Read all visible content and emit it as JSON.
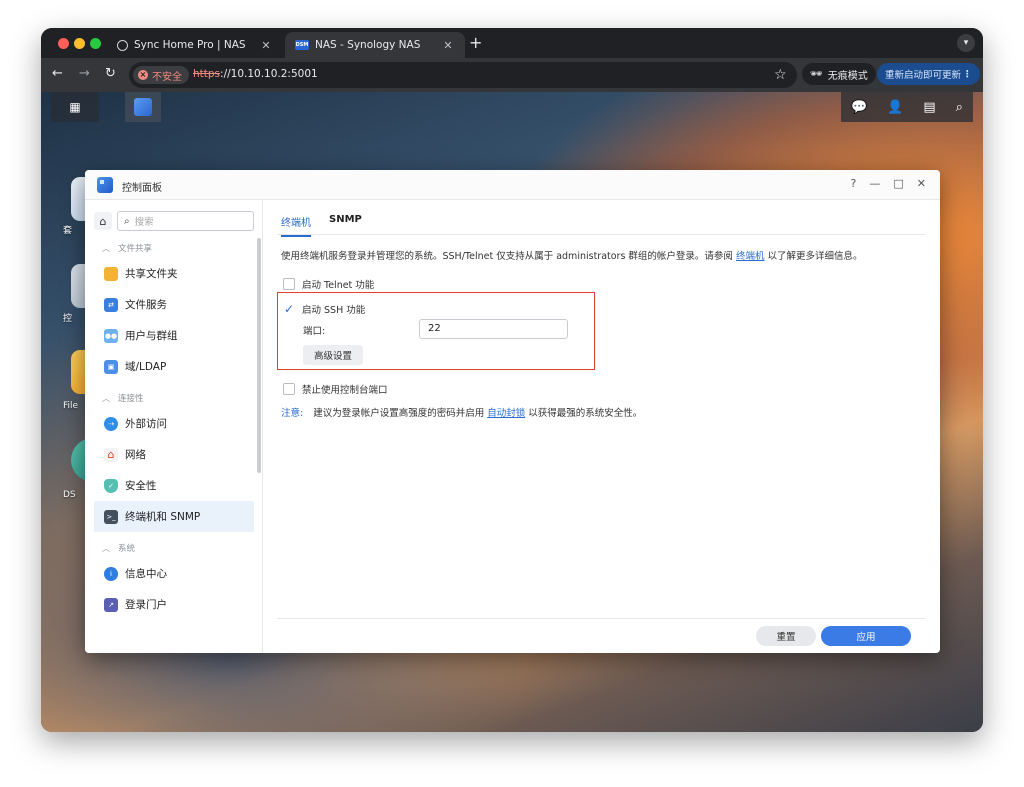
{
  "browser": {
    "tabs": [
      {
        "title": "Sync Home Pro | NAS",
        "close": "✕"
      },
      {
        "title": "NAS - Synology NAS",
        "close": "✕",
        "icon_text": "DSM"
      }
    ],
    "new_tab": "+",
    "address": {
      "security_label": "不安全",
      "scheme": "https",
      "rest": "://10.10.10.2:5001"
    },
    "incognito_label": "无痕模式",
    "relaunch_label": "重新启动即可更新",
    "colors": {
      "frame": "#202124",
      "toolbar": "#35363a",
      "insecure": "#f28b82"
    }
  },
  "desktop": {
    "icons": [
      {
        "label": "套",
        "glyph": "S"
      },
      {
        "label": "控"
      },
      {
        "label": "File"
      },
      {
        "label": "DS"
      }
    ]
  },
  "control_panel": {
    "title": "控制面板",
    "window_controls": {
      "help": "?",
      "minimize": "—",
      "maximize": "□",
      "close": "✕"
    },
    "search_placeholder": "搜索",
    "sidebar": {
      "sections": [
        {
          "header": "文件共享",
          "items": [
            "共享文件夹",
            "文件服务",
            "用户与群组",
            "域/LDAP"
          ]
        },
        {
          "header": "连接性",
          "items": [
            "外部访问",
            "网络",
            "安全性",
            "终端机和 SNMP"
          ]
        },
        {
          "header": "系统",
          "items": [
            "信息中心",
            "登录门户"
          ]
        }
      ],
      "active_item": "终端机和 SNMP"
    },
    "tabs": [
      {
        "label": "终端机",
        "active": true
      },
      {
        "label": "SNMP",
        "active": false
      }
    ],
    "description": {
      "text": "使用终端机服务登录并管理您的系统。SSH/Telnet 仅支持从属于 administrators 群组的帐户登录。请参阅",
      "link": "终端机",
      "suffix": "以了解更多详细信息。"
    },
    "telnet": {
      "label": "启动 Telnet 功能",
      "checked": false
    },
    "ssh": {
      "label": "启动 SSH 功能",
      "checked": true
    },
    "port": {
      "label": "端口:",
      "value": "22"
    },
    "advanced_button": "高级设置",
    "console_port": {
      "label": "禁止使用控制台端口",
      "checked": false
    },
    "note": {
      "label": "注意:",
      "text": "建议为登录帐户设置高强度的密码并启用",
      "link": "自动封锁",
      "suffix": "以获得最强的系统安全性。"
    },
    "buttons": {
      "reset": "重置",
      "apply": "应用"
    },
    "colors": {
      "accent": "#2a6bd1",
      "apply": "#3a7be6",
      "highlight_border": "#e0412b"
    }
  }
}
